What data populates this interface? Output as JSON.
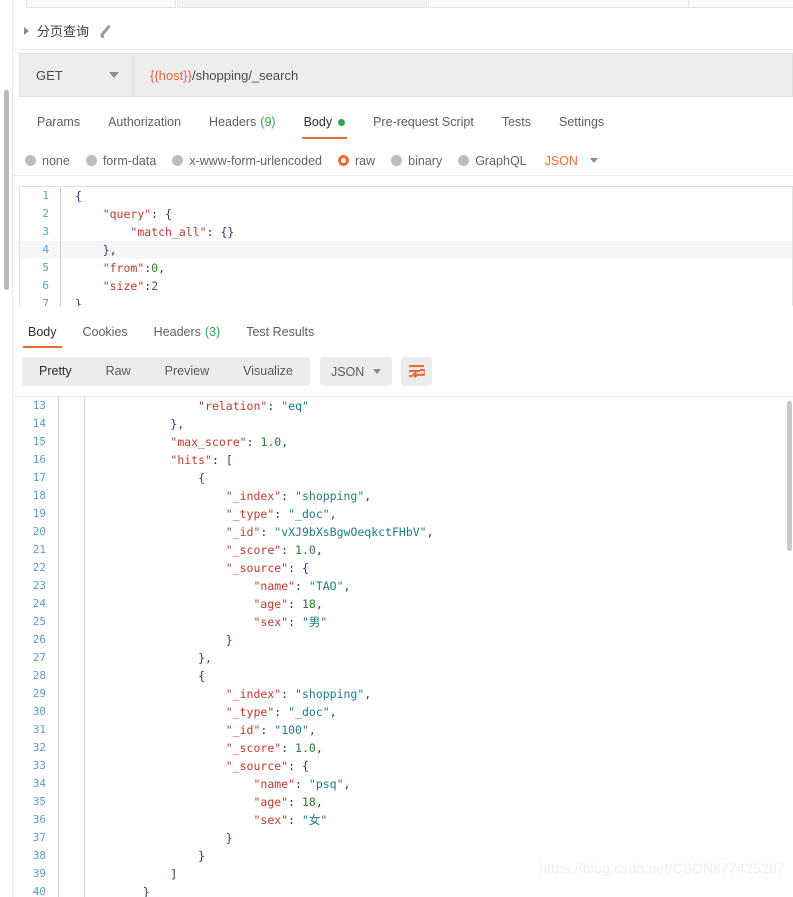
{
  "request": {
    "name": "分页查询",
    "method": "GET",
    "url_var": "{{host}}",
    "url_path": "/shopping/_search",
    "tabs": [
      {
        "label": "Params",
        "active": false,
        "count": "",
        "dot": false
      },
      {
        "label": "Authorization",
        "active": false,
        "count": "",
        "dot": false
      },
      {
        "label": "Headers",
        "active": false,
        "count": "(9)",
        "dot": false
      },
      {
        "label": "Body",
        "active": true,
        "count": "",
        "dot": true
      },
      {
        "label": "Pre-request Script",
        "active": false,
        "count": "",
        "dot": false
      },
      {
        "label": "Tests",
        "active": false,
        "count": "",
        "dot": false
      },
      {
        "label": "Settings",
        "active": false,
        "count": "",
        "dot": false
      }
    ],
    "body_types": [
      {
        "label": "none",
        "selected": false
      },
      {
        "label": "form-data",
        "selected": false
      },
      {
        "label": "x-www-form-urlencoded",
        "selected": false
      },
      {
        "label": "raw",
        "selected": true
      },
      {
        "label": "binary",
        "selected": false
      },
      {
        "label": "GraphQL",
        "selected": false
      }
    ],
    "raw_format": "JSON",
    "body_lines": [
      {
        "n": "1",
        "text": "{",
        "hl": false
      },
      {
        "n": "2",
        "text": "    \"query\": {",
        "hl": false
      },
      {
        "n": "3",
        "text": "        \"match_all\": {}",
        "hl": false
      },
      {
        "n": "4",
        "text": "    },",
        "hl": true
      },
      {
        "n": "5",
        "text": "    \"from\":0,",
        "hl": false
      },
      {
        "n": "6",
        "text": "    \"size\":2",
        "hl": false
      },
      {
        "n": "7",
        "text": "}",
        "hl": false
      }
    ]
  },
  "response": {
    "tabs": [
      {
        "label": "Body",
        "active": true,
        "count": ""
      },
      {
        "label": "Cookies",
        "active": false,
        "count": ""
      },
      {
        "label": "Headers",
        "active": false,
        "count": "(3)"
      },
      {
        "label": "Test Results",
        "active": false,
        "count": ""
      }
    ],
    "view_modes": [
      {
        "label": "Pretty",
        "active": true
      },
      {
        "label": "Raw",
        "active": false
      },
      {
        "label": "Preview",
        "active": false
      },
      {
        "label": "Visualize",
        "active": false
      }
    ],
    "format": "JSON",
    "wrap_icon": "word-wrap-icon",
    "lines": [
      {
        "n": "13",
        "text": "            \"relation\": \"eq\""
      },
      {
        "n": "14",
        "text": "        },"
      },
      {
        "n": "15",
        "text": "        \"max_score\": 1.0,"
      },
      {
        "n": "16",
        "text": "        \"hits\": ["
      },
      {
        "n": "17",
        "text": "            {"
      },
      {
        "n": "18",
        "text": "                \"_index\": \"shopping\","
      },
      {
        "n": "19",
        "text": "                \"_type\": \"_doc\","
      },
      {
        "n": "20",
        "text": "                \"_id\": \"vXJ9bXsBgwOeqkctFHbV\","
      },
      {
        "n": "21",
        "text": "                \"_score\": 1.0,"
      },
      {
        "n": "22",
        "text": "                \"_source\": {"
      },
      {
        "n": "23",
        "text": "                    \"name\": \"TAO\","
      },
      {
        "n": "24",
        "text": "                    \"age\": 18,"
      },
      {
        "n": "25",
        "text": "                    \"sex\": \"男\""
      },
      {
        "n": "26",
        "text": "                }"
      },
      {
        "n": "27",
        "text": "            },"
      },
      {
        "n": "28",
        "text": "            {"
      },
      {
        "n": "29",
        "text": "                \"_index\": \"shopping\","
      },
      {
        "n": "30",
        "text": "                \"_type\": \"_doc\","
      },
      {
        "n": "31",
        "text": "                \"_id\": \"100\","
      },
      {
        "n": "32",
        "text": "                \"_score\": 1.0,"
      },
      {
        "n": "33",
        "text": "                \"_source\": {"
      },
      {
        "n": "34",
        "text": "                    \"name\": \"psq\","
      },
      {
        "n": "35",
        "text": "                    \"age\": 18,"
      },
      {
        "n": "36",
        "text": "                    \"sex\": \"女\""
      },
      {
        "n": "37",
        "text": "                }"
      },
      {
        "n": "38",
        "text": "            }"
      },
      {
        "n": "39",
        "text": "        ]"
      },
      {
        "n": "40",
        "text": "    }"
      }
    ]
  },
  "watermark": "https://blog.csdn.net/CSDN877425287",
  "colors": {
    "accent": "#ef6b33",
    "green": "#29a745",
    "line_number": "#5a9ac9",
    "json_key": "#c0392b",
    "json_string": "#1f7a85",
    "json_number": "#2a7a2a"
  }
}
